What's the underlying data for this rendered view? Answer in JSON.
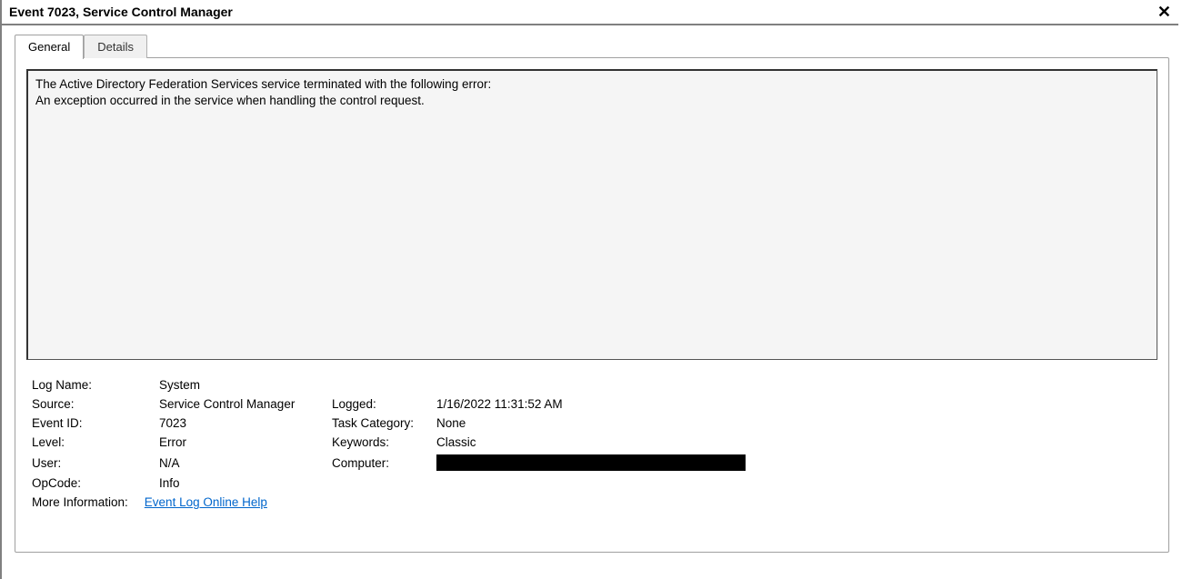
{
  "window": {
    "title": "Event 7023, Service Control Manager"
  },
  "tabs": {
    "general": "General",
    "details": "Details"
  },
  "message": "The Active Directory Federation Services service terminated with the following error:\nAn exception occurred in the service when handling the control request.",
  "props": {
    "log_name_label": "Log Name:",
    "log_name_value": "System",
    "source_label": "Source:",
    "source_value": "Service Control Manager",
    "logged_label": "Logged:",
    "logged_value": "1/16/2022 11:31:52 AM",
    "event_id_label": "Event ID:",
    "event_id_value": "7023",
    "task_category_label": "Task Category:",
    "task_category_value": "None",
    "level_label": "Level:",
    "level_value": "Error",
    "keywords_label": "Keywords:",
    "keywords_value": "Classic",
    "user_label": "User:",
    "user_value": "N/A",
    "computer_label": "Computer:",
    "opcode_label": "OpCode:",
    "opcode_value": "Info",
    "more_info_label": "More Information:",
    "more_info_link": "Event Log Online Help"
  }
}
